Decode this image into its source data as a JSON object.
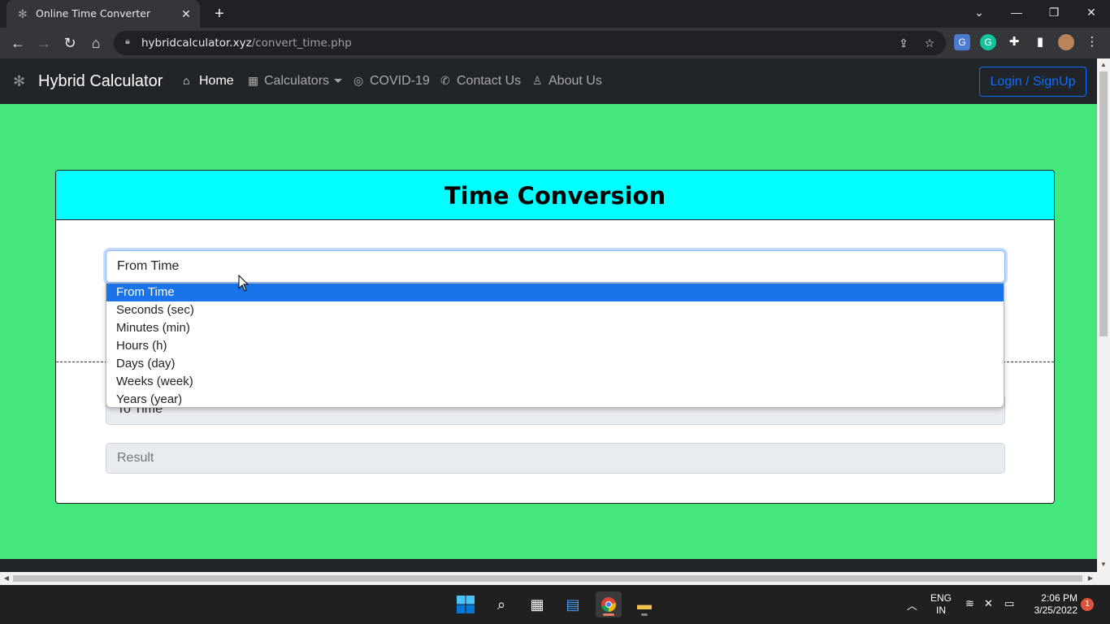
{
  "browser": {
    "tab_title": "Online Time Converter",
    "url_domain": "hybridcalculator.xyz",
    "url_path": "/convert_time.php"
  },
  "navbar": {
    "brand": "Hybrid Calculator",
    "links": [
      {
        "label": "Home",
        "icon": "home-icon"
      },
      {
        "label": "Calculators",
        "icon": "calculator-icon"
      },
      {
        "label": "COVID-19",
        "icon": "virus-icon"
      },
      {
        "label": "Contact Us",
        "icon": "phone-icon"
      },
      {
        "label": "About Us",
        "icon": "user-icon"
      }
    ],
    "login_label": "Login / SignUp"
  },
  "card": {
    "title": "Time Conversion",
    "from_select_value": "From Time",
    "to_select_value": "To Time",
    "result_placeholder": "Result"
  },
  "dropdown": {
    "options": [
      "From Time",
      "Seconds (sec)",
      "Minutes (min)",
      "Hours (h)",
      "Days (day)",
      "Weeks (week)",
      "Years (year)"
    ],
    "selected_index": 0
  },
  "taskbar": {
    "lang_top": "ENG",
    "lang_bottom": "IN",
    "time": "2:06 PM",
    "date": "3/25/2022",
    "notification_count": "1"
  },
  "colors": {
    "page_bg": "#45e67c",
    "header_bg": "#00ffff",
    "accent": "#0d6efd",
    "dropdown_selected": "#1a73e8"
  }
}
